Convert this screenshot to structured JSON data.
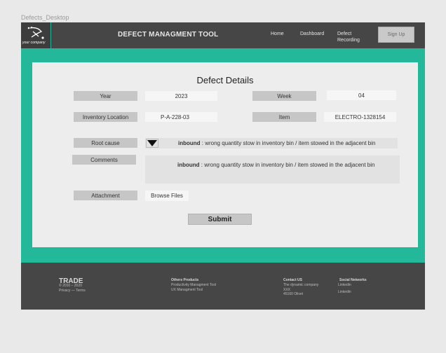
{
  "frame_label": "Defects_Desktop",
  "header": {
    "logo_text": "your company",
    "title": "DEFECT MANAGMENT TOOL",
    "nav": {
      "home": "Home",
      "dashboard": "Dashboard",
      "defect_recording_line1": "Defect",
      "defect_recording_line2": "Recording"
    },
    "signup": "Sign Up"
  },
  "form": {
    "title": "Defect Details",
    "year": {
      "label": "Year",
      "value": "2023"
    },
    "week": {
      "label": "Week",
      "value": "04"
    },
    "inventory_location": {
      "label": "Inventory Location",
      "value": "P-A-228-03"
    },
    "item": {
      "label": "Item",
      "value": "ELECTRO-1328154"
    },
    "root_cause": {
      "label": "Root cause",
      "value_bold": "inbound",
      "value_rest": " : wrong quantity stow in inventory bin / item stowed in the adjacent bin"
    },
    "comments": {
      "label": "Comments",
      "value_bold": "inbound",
      "value_rest": " : wrong quantity stow in inventory bin / item stowed in the adjacent bin"
    },
    "attachment": {
      "label": "Attachment",
      "browse": "Browse Files"
    },
    "submit": "Submit"
  },
  "footer": {
    "brand": "TRADE",
    "copyright": "© 2010 – 2020",
    "privacy": "Privacy — Terms",
    "products_heading": "Others Products",
    "products": [
      "Productivity Managment Tool",
      "UX Managment Tool"
    ],
    "contact_heading": "Contact US",
    "contact": [
      "The dynamic company",
      "XXX",
      "45160 Olivet"
    ],
    "social_heading": "Social Networks",
    "social": [
      "Linkedin",
      "Linkedin"
    ]
  },
  "colors": {
    "accent": "#23b899",
    "dark": "#464646",
    "field": "#c6c6c6"
  }
}
